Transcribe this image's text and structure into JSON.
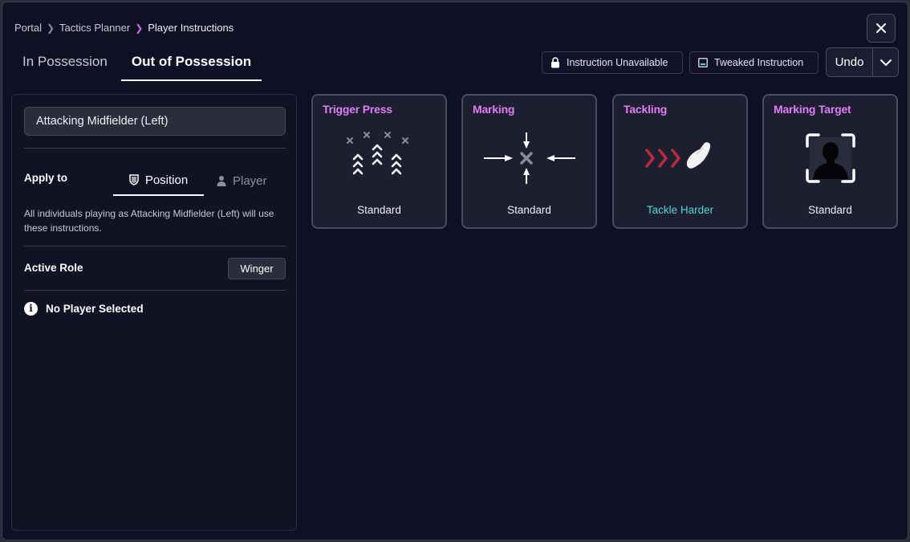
{
  "breadcrumb": {
    "items": [
      "Portal",
      "Tactics Planner",
      "Player Instructions"
    ]
  },
  "tabs": [
    {
      "label": "In Possession",
      "active": false
    },
    {
      "label": "Out of Possession",
      "active": true
    }
  ],
  "legend": {
    "unavailable_label": "Instruction Unavailable",
    "tweaked_label": "Tweaked Instruction"
  },
  "undo": {
    "label": "Undo"
  },
  "sidebar": {
    "position_value": "Attacking Midfielder (Left)",
    "apply_label": "Apply to",
    "apply_tabs": [
      {
        "label": "Position",
        "active": true
      },
      {
        "label": "Player",
        "active": false
      }
    ],
    "apply_description": "All individuals playing as Attacking Midfielder (Left) will use these instructions.",
    "active_role_label": "Active Role",
    "active_role_value": "Winger",
    "no_player_label": "No Player Selected"
  },
  "instructions": [
    {
      "title": "Trigger Press",
      "value": "Standard",
      "icon": "trigger-press-icon",
      "tweaked": false
    },
    {
      "title": "Marking",
      "value": "Standard",
      "icon": "marking-icon",
      "tweaked": false
    },
    {
      "title": "Tackling",
      "value": "Tackle Harder",
      "icon": "tackling-icon",
      "tweaked": true
    },
    {
      "title": "Marking Target",
      "value": "Standard",
      "icon": "marking-target-icon",
      "tweaked": false
    }
  ],
  "colors": {
    "background": "#0f1023",
    "card_title": "#e07ef5",
    "tweaked_value": "#4fd8d8",
    "tackle_arrows": "#c0293a",
    "breadcrumb_accent": "#c56cf0"
  }
}
